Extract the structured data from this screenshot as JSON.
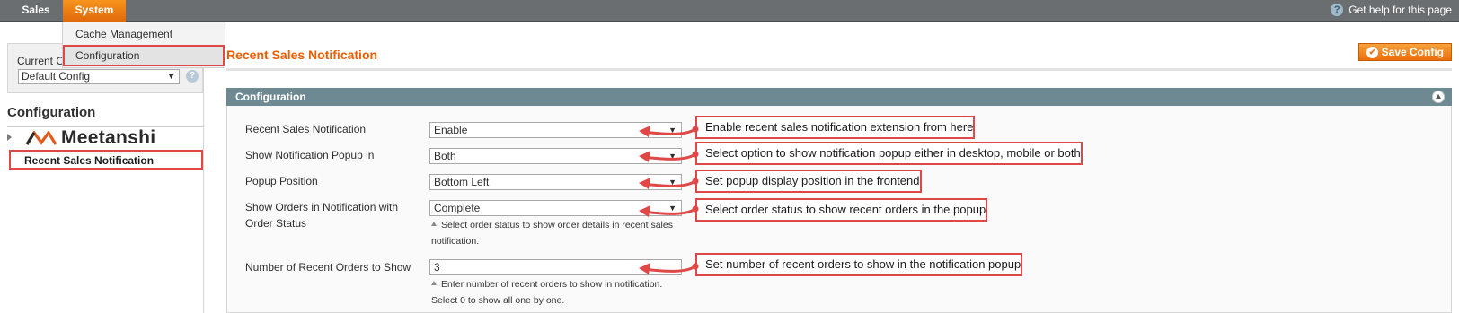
{
  "nav": {
    "sales": "Sales",
    "system": "System",
    "help": "Get help for this page"
  },
  "menu": {
    "cache": "Cache Management",
    "configuration": "Configuration"
  },
  "scope": {
    "label": "Current C",
    "value": "Default Config"
  },
  "sidebar": {
    "title": "Configuration",
    "group": "Meetanshi",
    "item": "Recent Sales Notification"
  },
  "page": {
    "title": "Recent Sales Notification",
    "save_label": "Save Config",
    "section": "Configuration"
  },
  "rows": [
    {
      "label": "Recent Sales Notification",
      "value": "Enable"
    },
    {
      "label": "Show Notification Popup in",
      "value": "Both"
    },
    {
      "label": "Popup Position",
      "value": "Bottom Left"
    },
    {
      "label": "Show Orders in Notification with Order Status",
      "value": "Complete",
      "note": "Select order status to show order details in recent sales notification."
    },
    {
      "label": "Number of Recent Orders to Show",
      "value": "3",
      "note": "Enter number of recent orders to show in notification. Select 0 to show all one by one."
    }
  ],
  "callouts": [
    "Enable recent sales notification extension from here",
    "Select option to show notification popup either in desktop, mobile or both",
    "Set popup display position in the frontend",
    "Select order status to show recent orders in the popup",
    "Set number of recent orders to show in the notification popup"
  ],
  "colors": {
    "accent": "#eb5e00",
    "annotation": "#e04848",
    "section_header": "#6f8992",
    "nav_bg": "#6b6e70"
  }
}
